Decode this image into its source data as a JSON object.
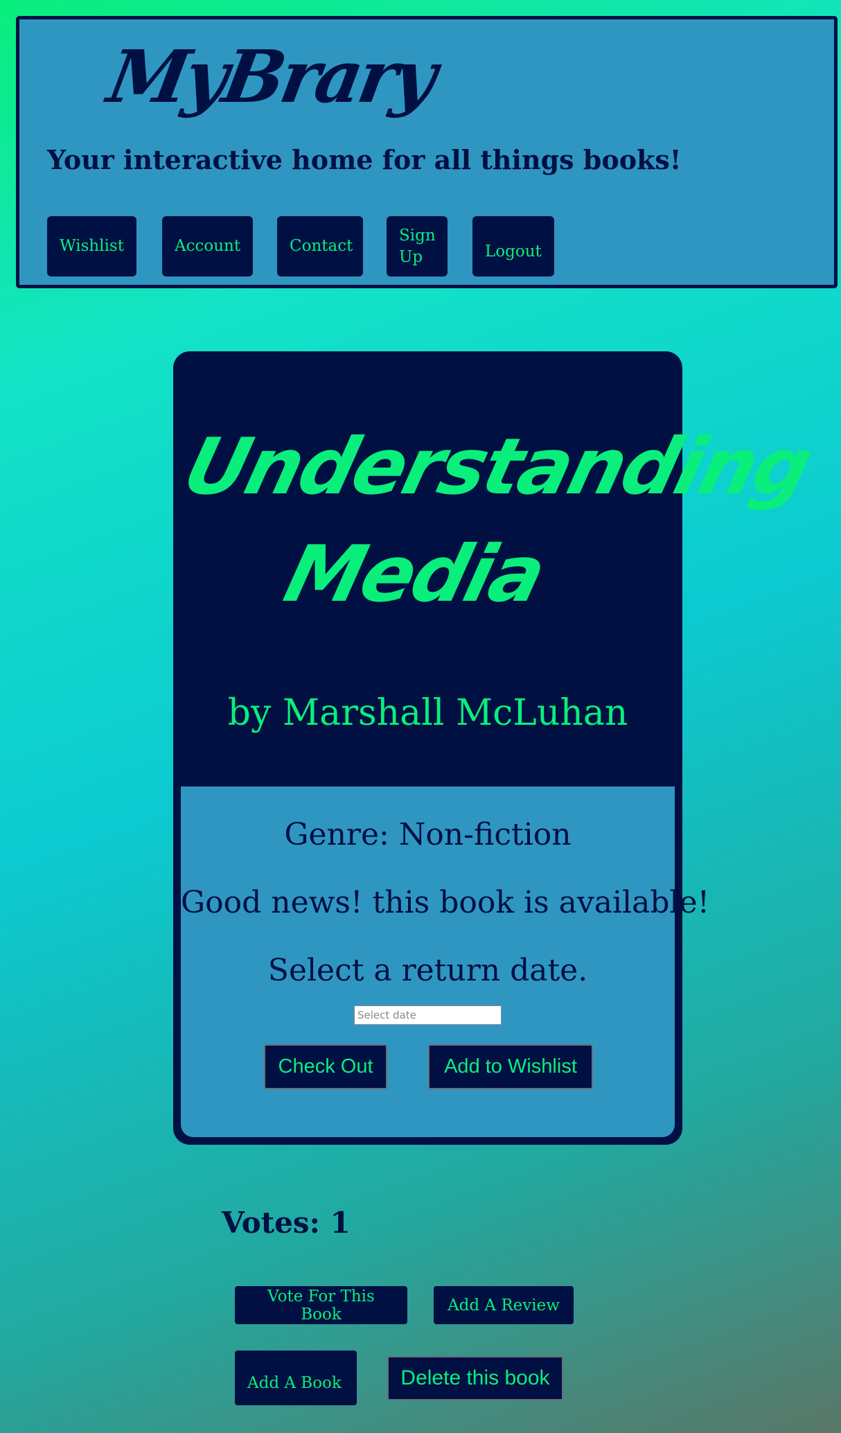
{
  "header": {
    "logo": "MyBrary",
    "tagline": "Your interactive home for all things books!",
    "nav": {
      "wishlist": "Wishlist",
      "account": "Account",
      "contact": "Contact",
      "signup_line1": "Sign",
      "signup_line2": "Up",
      "logout": "Logout"
    }
  },
  "book": {
    "title_line1": "Understanding",
    "title_line2": "Media",
    "author": "by Marshall McLuhan",
    "genre": "Genre: Non-fiction",
    "availability": "Good news! this book is available!",
    "return_prompt": "Select a return date.",
    "date_placeholder": "Select date",
    "checkout_label": "Check Out",
    "wishlist_label": "Add to Wishlist"
  },
  "votes": {
    "label": "Votes: 1"
  },
  "actions": {
    "vote": "Vote For This Book",
    "review": "Add A Review",
    "add_book": "Add A Book",
    "delete": "Delete this book"
  },
  "colors": {
    "navy": "#011043",
    "green": "#0aee7c",
    "blue": "#2f96c1"
  }
}
